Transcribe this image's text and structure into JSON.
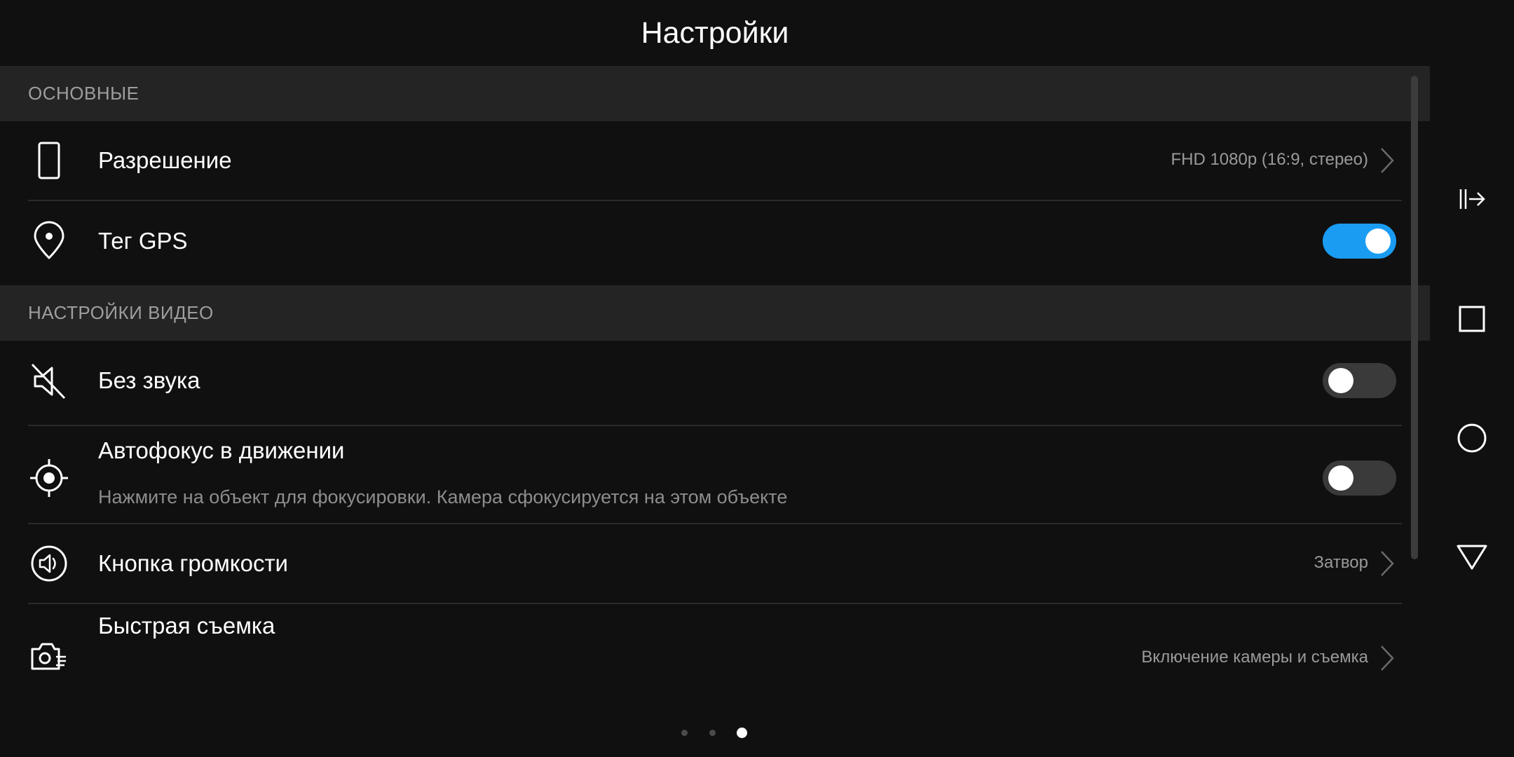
{
  "header": {
    "title": "Настройки"
  },
  "sections": {
    "basic": "ОСНОВНЫЕ",
    "video": "НАСТРОЙКИ ВИДЕО"
  },
  "rows": {
    "resolution": {
      "label": "Разрешение",
      "value": "FHD 1080p (16:9, стерео)",
      "icon": "phone-icon"
    },
    "gps": {
      "label": "Тег GPS",
      "toggle_on": true,
      "icon": "location-pin-icon"
    },
    "mute": {
      "label": "Без звука",
      "toggle_on": false,
      "icon": "mute-speaker-icon"
    },
    "autofocus": {
      "label": "Автофокус в движении",
      "description": "Нажмите на объект для фокусировки. Камера сфокусируется на этом объекте",
      "toggle_on": false,
      "icon": "focus-target-icon"
    },
    "volume_button": {
      "label": "Кнопка громкости",
      "value": "Затвор",
      "icon": "volume-icon"
    },
    "quick_shot": {
      "label": "Быстрая съемка",
      "value": "Включение камеры и съемка",
      "icon": "quick-camera-icon"
    }
  },
  "pagination": {
    "total": 3,
    "active_index": 2
  },
  "navigation": [
    "sidebar-toggle-icon",
    "recents-square-icon",
    "home-circle-icon",
    "back-triangle-icon"
  ],
  "colors": {
    "background": "#101010",
    "section": "#242424",
    "accent": "#1a9cf3"
  }
}
